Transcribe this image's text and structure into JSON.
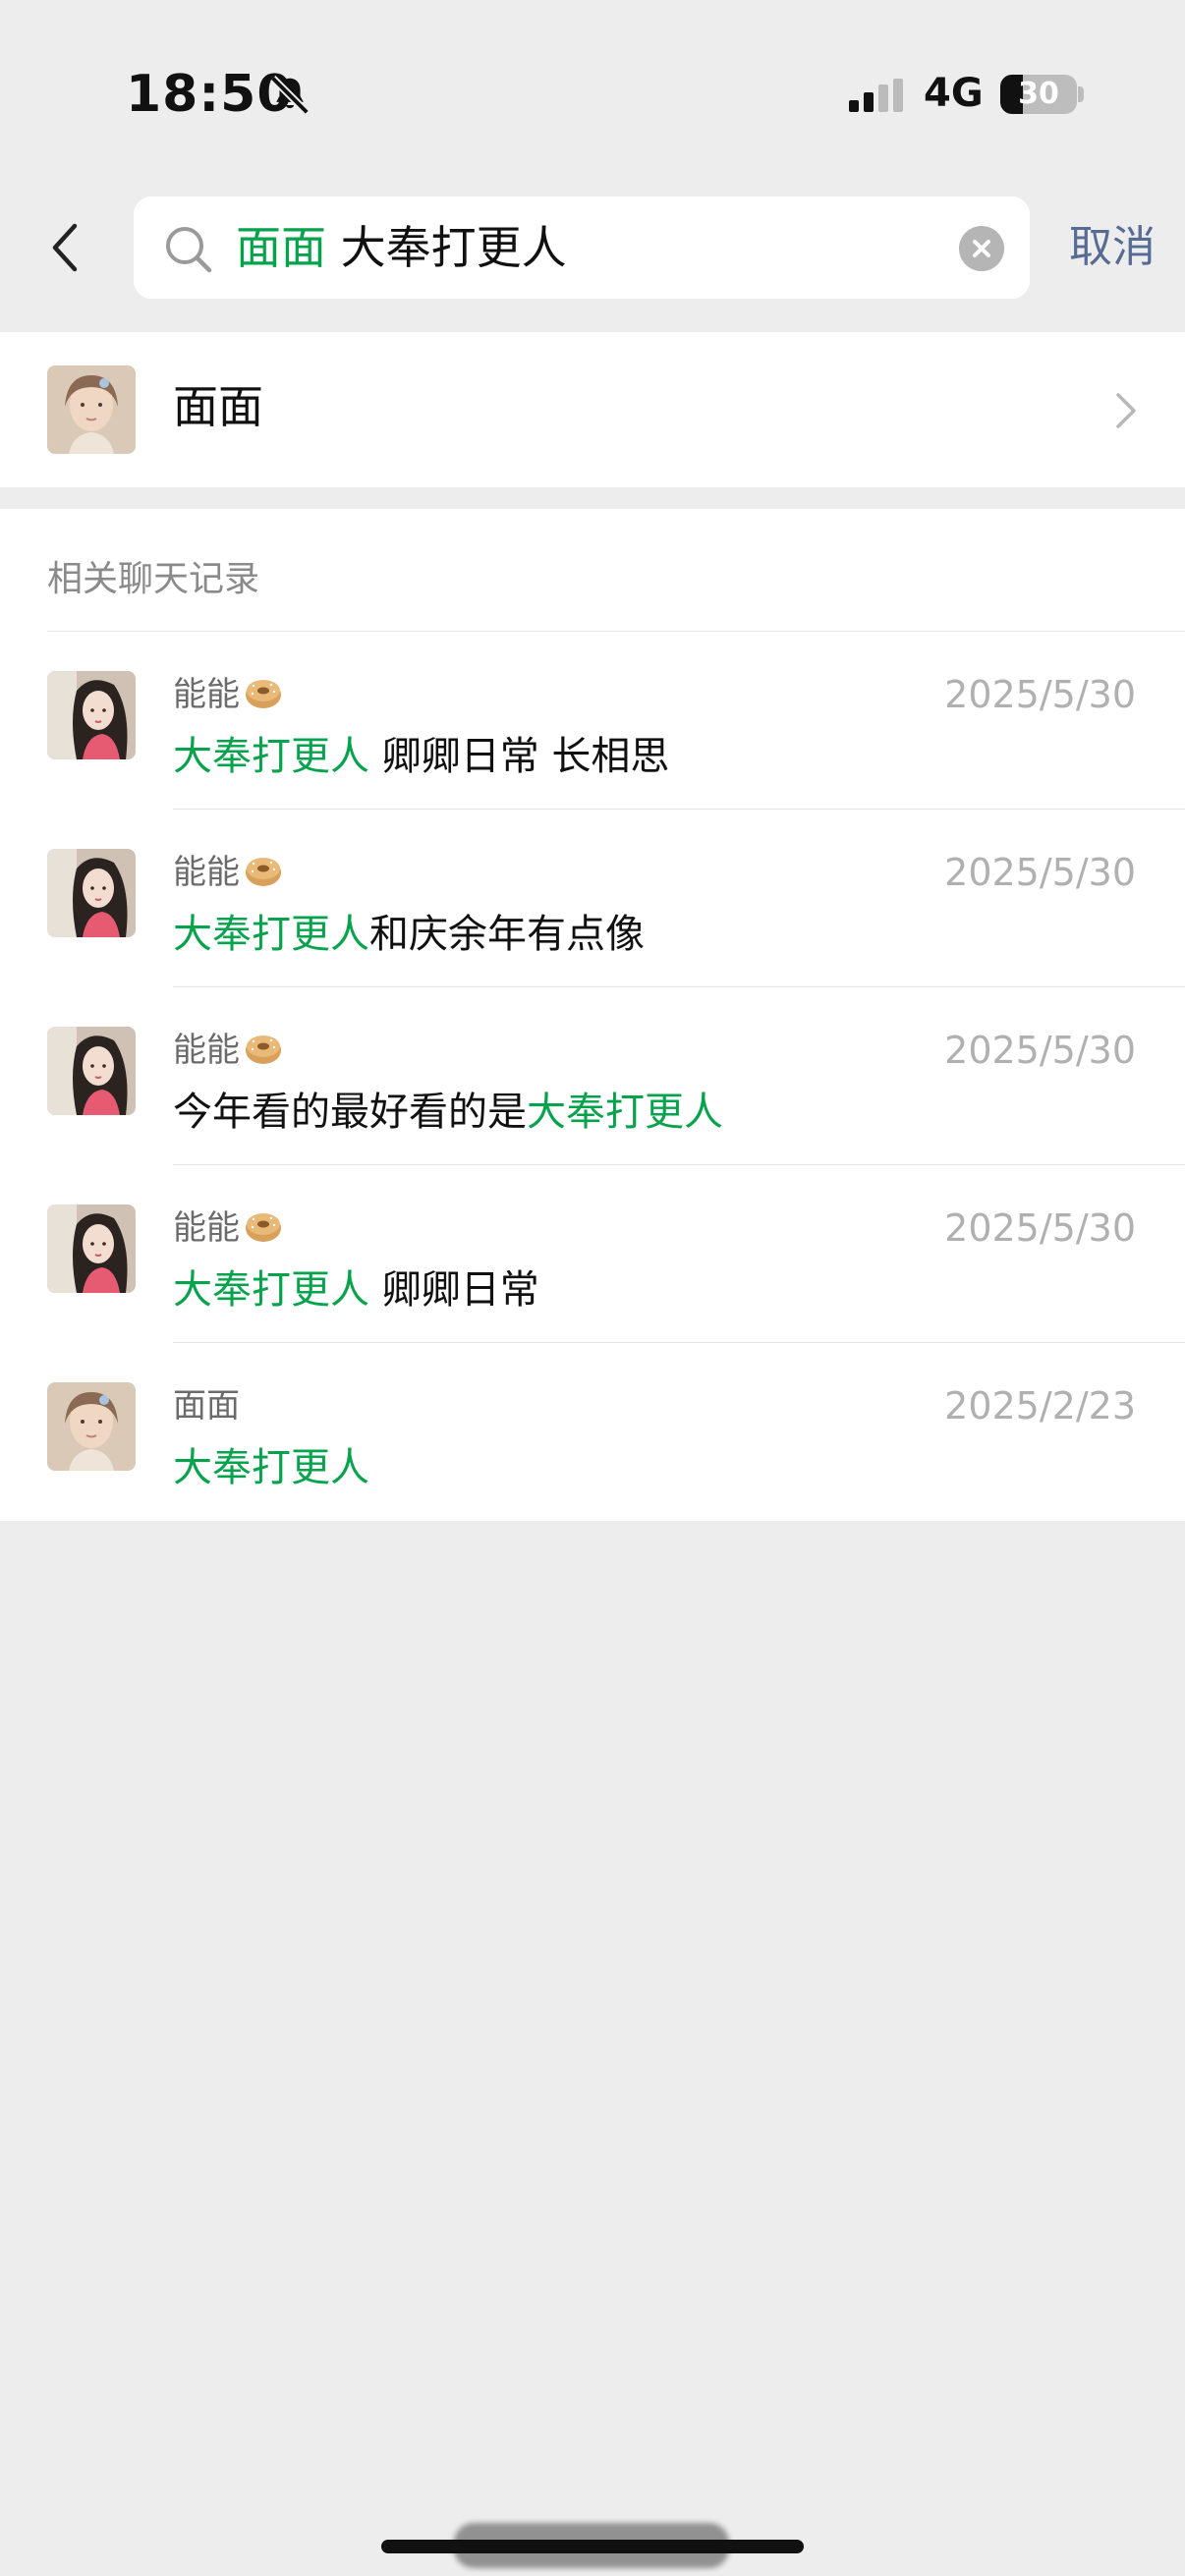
{
  "status_bar": {
    "time": "18:50",
    "network": "4G",
    "battery": "30",
    "battery_level": 0.3,
    "icons": [
      "bell-muted-icon",
      "signal-icon",
      "battery-icon"
    ]
  },
  "search": {
    "back_icon": "chevron-left-icon",
    "search_icon": "search-icon",
    "token": "面面",
    "query": " 大奉打更人",
    "clear_icon": "clear-circle-icon",
    "cancel_label": "取消"
  },
  "contact": {
    "name": "面面",
    "arrow_icon": "chevron-right-icon"
  },
  "records": {
    "header": "相关聊天记录",
    "items": [
      {
        "sender": "能能",
        "emoji_icon": "bagel-emoji-icon",
        "date": "2025/5/30",
        "pre": "",
        "hl": "大奉打更人",
        "post": " 卿卿日常 长相思"
      },
      {
        "sender": "能能",
        "emoji_icon": "bagel-emoji-icon",
        "date": "2025/5/30",
        "pre": "",
        "hl": "大奉打更人",
        "post": "和庆余年有点像"
      },
      {
        "sender": "能能",
        "emoji_icon": "bagel-emoji-icon",
        "date": "2025/5/30",
        "pre": "今年看的最好看的是",
        "hl": "大奉打更人",
        "post": ""
      },
      {
        "sender": "能能",
        "emoji_icon": "bagel-emoji-icon",
        "date": "2025/5/30",
        "pre": "",
        "hl": "大奉打更人",
        "post": " 卿卿日常"
      },
      {
        "sender": "面面",
        "date": "2025/2/23",
        "pre": "",
        "hl": "大奉打更人",
        "post": ""
      }
    ]
  },
  "colors": {
    "highlight": "#07a34c",
    "link": "#576b95",
    "background": "#ededed"
  }
}
